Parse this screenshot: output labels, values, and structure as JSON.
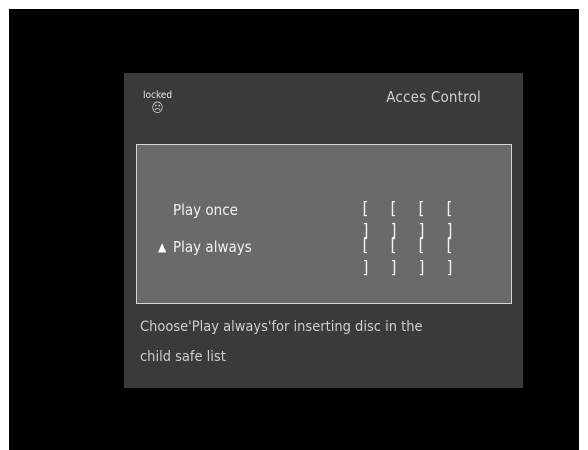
{
  "status": {
    "label": "locked",
    "icon": "☹"
  },
  "title": "Acces Control",
  "rows": [
    {
      "label": "Play once",
      "marker": "",
      "digits": [
        "[ ]",
        "[ ]",
        "[ ]",
        "[ ]"
      ]
    },
    {
      "label": "Play always",
      "marker": "▲",
      "digits": [
        "[ ]",
        "[ ]",
        "[ ]",
        "[ ]"
      ]
    }
  ],
  "hint": {
    "line1": "Choose'Play always'for inserting disc in the",
    "line2": "child safe list"
  }
}
